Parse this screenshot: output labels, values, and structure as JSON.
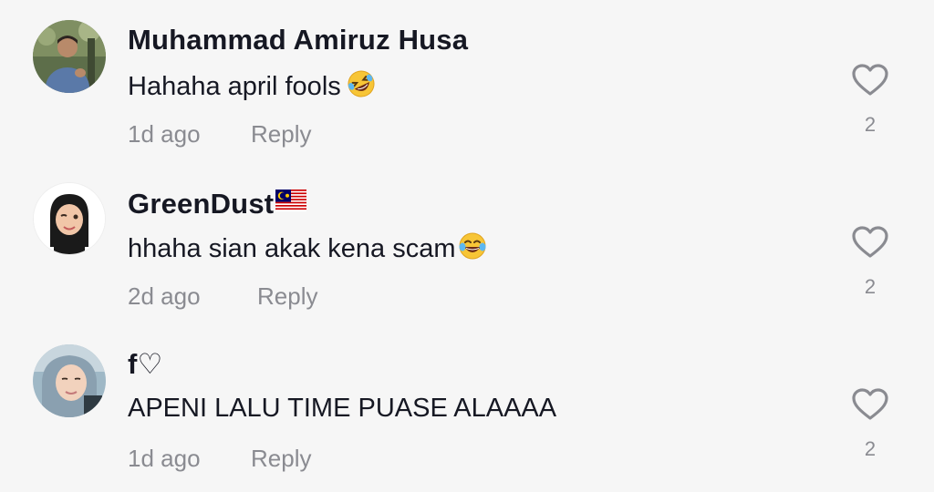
{
  "comments": [
    {
      "username": "Muhammad Amiruz Husa",
      "text": "Hahaha april fools",
      "emoji": "rolling-on-floor-laughing-emoji",
      "time": "1d ago",
      "reply_label": "Reply",
      "likes": "2"
    },
    {
      "username": "GreenDust",
      "username_suffix": "malaysia-flag-emoji",
      "text": "hhaha sian akak kena scam",
      "emoji": "tears-of-joy-emoji",
      "time": "2d ago",
      "reply_label": "Reply",
      "likes": "2"
    },
    {
      "username": "f♡",
      "text": "APENI LALU TIME PUASE ALAAAA",
      "time": "1d ago",
      "reply_label": "Reply",
      "likes": "2"
    }
  ]
}
